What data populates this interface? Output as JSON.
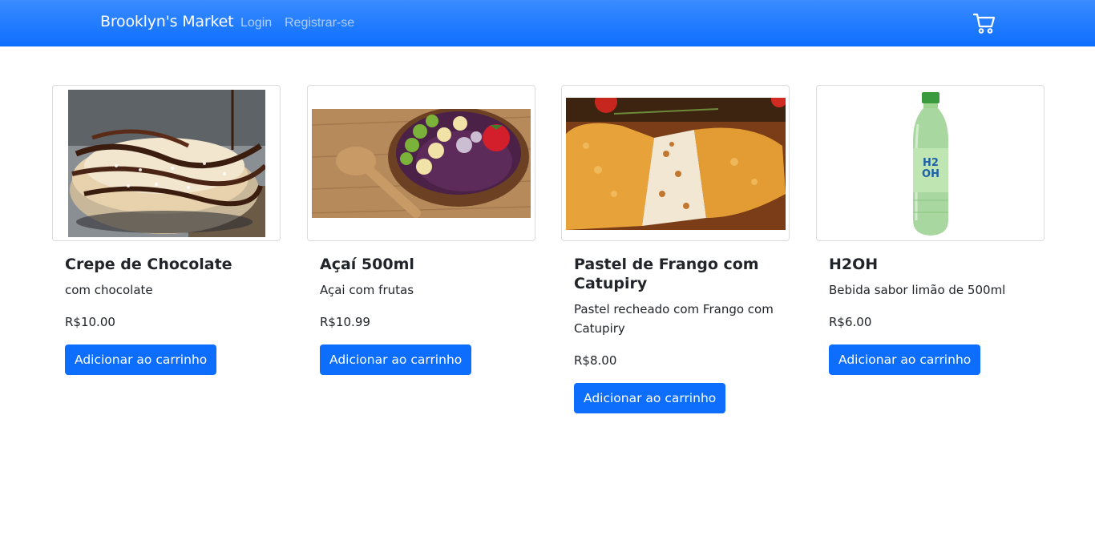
{
  "navbar": {
    "brand": "Brooklyn's Market",
    "login": "Login",
    "register": "Registrar-se",
    "cart_icon": "cart-icon"
  },
  "colors": {
    "primary": "#0d6efd",
    "navbar_top": "#3a8cff"
  },
  "products": [
    {
      "title": "Crepe de Chocolate",
      "description": "com chocolate",
      "price": "R$10.00",
      "button": "Adicionar ao carrinho",
      "image": "crepe-image"
    },
    {
      "title": "Açaí 500ml",
      "description": "Açai com frutas",
      "price": "R$10.99",
      "button": "Adicionar ao carrinho",
      "image": "acai-image"
    },
    {
      "title": "Pastel de Frango com Catupiry",
      "description": "Pastel recheado com Frango com Catupiry",
      "price": "R$8.00",
      "button": "Adicionar ao carrinho",
      "image": "pastel-image"
    },
    {
      "title": "H2OH",
      "description": "Bebida sabor limão de 500ml",
      "price": "R$6.00",
      "button": "Adicionar ao carrinho",
      "image": "h2oh-bottle-image"
    }
  ]
}
